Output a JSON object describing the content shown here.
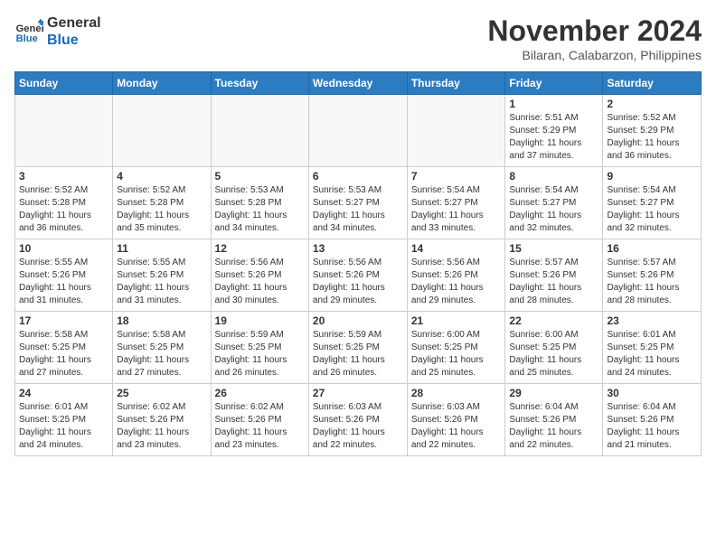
{
  "header": {
    "logo_line1": "General",
    "logo_line2": "Blue",
    "title": "November 2024",
    "location": "Bilaran, Calabarzon, Philippines"
  },
  "weekdays": [
    "Sunday",
    "Monday",
    "Tuesday",
    "Wednesday",
    "Thursday",
    "Friday",
    "Saturday"
  ],
  "weeks": [
    [
      {
        "day": "",
        "info": ""
      },
      {
        "day": "",
        "info": ""
      },
      {
        "day": "",
        "info": ""
      },
      {
        "day": "",
        "info": ""
      },
      {
        "day": "",
        "info": ""
      },
      {
        "day": "1",
        "info": "Sunrise: 5:51 AM\nSunset: 5:29 PM\nDaylight: 11 hours\nand 37 minutes."
      },
      {
        "day": "2",
        "info": "Sunrise: 5:52 AM\nSunset: 5:29 PM\nDaylight: 11 hours\nand 36 minutes."
      }
    ],
    [
      {
        "day": "3",
        "info": "Sunrise: 5:52 AM\nSunset: 5:28 PM\nDaylight: 11 hours\nand 36 minutes."
      },
      {
        "day": "4",
        "info": "Sunrise: 5:52 AM\nSunset: 5:28 PM\nDaylight: 11 hours\nand 35 minutes."
      },
      {
        "day": "5",
        "info": "Sunrise: 5:53 AM\nSunset: 5:28 PM\nDaylight: 11 hours\nand 34 minutes."
      },
      {
        "day": "6",
        "info": "Sunrise: 5:53 AM\nSunset: 5:27 PM\nDaylight: 11 hours\nand 34 minutes."
      },
      {
        "day": "7",
        "info": "Sunrise: 5:54 AM\nSunset: 5:27 PM\nDaylight: 11 hours\nand 33 minutes."
      },
      {
        "day": "8",
        "info": "Sunrise: 5:54 AM\nSunset: 5:27 PM\nDaylight: 11 hours\nand 32 minutes."
      },
      {
        "day": "9",
        "info": "Sunrise: 5:54 AM\nSunset: 5:27 PM\nDaylight: 11 hours\nand 32 minutes."
      }
    ],
    [
      {
        "day": "10",
        "info": "Sunrise: 5:55 AM\nSunset: 5:26 PM\nDaylight: 11 hours\nand 31 minutes."
      },
      {
        "day": "11",
        "info": "Sunrise: 5:55 AM\nSunset: 5:26 PM\nDaylight: 11 hours\nand 31 minutes."
      },
      {
        "day": "12",
        "info": "Sunrise: 5:56 AM\nSunset: 5:26 PM\nDaylight: 11 hours\nand 30 minutes."
      },
      {
        "day": "13",
        "info": "Sunrise: 5:56 AM\nSunset: 5:26 PM\nDaylight: 11 hours\nand 29 minutes."
      },
      {
        "day": "14",
        "info": "Sunrise: 5:56 AM\nSunset: 5:26 PM\nDaylight: 11 hours\nand 29 minutes."
      },
      {
        "day": "15",
        "info": "Sunrise: 5:57 AM\nSunset: 5:26 PM\nDaylight: 11 hours\nand 28 minutes."
      },
      {
        "day": "16",
        "info": "Sunrise: 5:57 AM\nSunset: 5:26 PM\nDaylight: 11 hours\nand 28 minutes."
      }
    ],
    [
      {
        "day": "17",
        "info": "Sunrise: 5:58 AM\nSunset: 5:25 PM\nDaylight: 11 hours\nand 27 minutes."
      },
      {
        "day": "18",
        "info": "Sunrise: 5:58 AM\nSunset: 5:25 PM\nDaylight: 11 hours\nand 27 minutes."
      },
      {
        "day": "19",
        "info": "Sunrise: 5:59 AM\nSunset: 5:25 PM\nDaylight: 11 hours\nand 26 minutes."
      },
      {
        "day": "20",
        "info": "Sunrise: 5:59 AM\nSunset: 5:25 PM\nDaylight: 11 hours\nand 26 minutes."
      },
      {
        "day": "21",
        "info": "Sunrise: 6:00 AM\nSunset: 5:25 PM\nDaylight: 11 hours\nand 25 minutes."
      },
      {
        "day": "22",
        "info": "Sunrise: 6:00 AM\nSunset: 5:25 PM\nDaylight: 11 hours\nand 25 minutes."
      },
      {
        "day": "23",
        "info": "Sunrise: 6:01 AM\nSunset: 5:25 PM\nDaylight: 11 hours\nand 24 minutes."
      }
    ],
    [
      {
        "day": "24",
        "info": "Sunrise: 6:01 AM\nSunset: 5:25 PM\nDaylight: 11 hours\nand 24 minutes."
      },
      {
        "day": "25",
        "info": "Sunrise: 6:02 AM\nSunset: 5:26 PM\nDaylight: 11 hours\nand 23 minutes."
      },
      {
        "day": "26",
        "info": "Sunrise: 6:02 AM\nSunset: 5:26 PM\nDaylight: 11 hours\nand 23 minutes."
      },
      {
        "day": "27",
        "info": "Sunrise: 6:03 AM\nSunset: 5:26 PM\nDaylight: 11 hours\nand 22 minutes."
      },
      {
        "day": "28",
        "info": "Sunrise: 6:03 AM\nSunset: 5:26 PM\nDaylight: 11 hours\nand 22 minutes."
      },
      {
        "day": "29",
        "info": "Sunrise: 6:04 AM\nSunset: 5:26 PM\nDaylight: 11 hours\nand 22 minutes."
      },
      {
        "day": "30",
        "info": "Sunrise: 6:04 AM\nSunset: 5:26 PM\nDaylight: 11 hours\nand 21 minutes."
      }
    ]
  ]
}
